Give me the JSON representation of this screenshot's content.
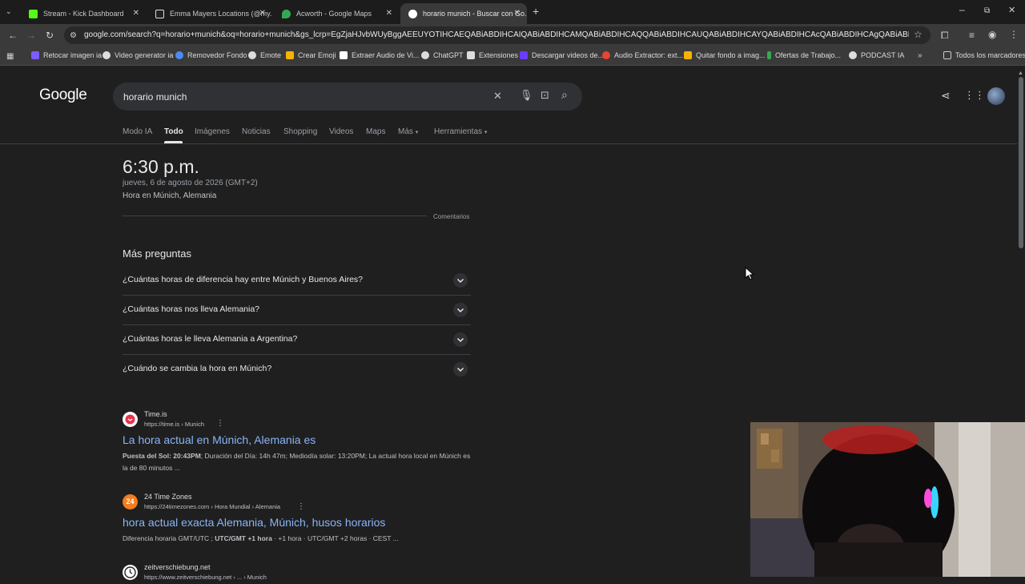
{
  "browser": {
    "tabs": [
      {
        "title": "Stream - Kick Dashboard",
        "color": "#53fc18"
      },
      {
        "title": "Emma Mayers Locations (@my...",
        "color": "#ffffff"
      },
      {
        "title": "Acworth - Google Maps",
        "color": "#34a853"
      },
      {
        "title": "horario munich - Buscar con Go...",
        "color": "#ffffff"
      }
    ],
    "url": "google.com/search?q=horario+munich&oq=horario+munich&gs_lcrp=EgZjaHJvbWUyBggAEEUYOTIHCAEQABiABDIHCAIQABiABDIHCAMQABiABDIHCAQQABiABDIHCAUQABiABDIHCAYQABiABDIHCAcQABiABDIHCAgQABiABDIHCAkQABiABNIBCDE...",
    "bookmarks": [
      {
        "label": "Retocar imagen ia",
        "color": "#7b5cff"
      },
      {
        "label": "Video generator ia",
        "color": "#dddddd"
      },
      {
        "label": "Removedor Fondo",
        "color": "#4c8bf5"
      },
      {
        "label": "Emote",
        "color": "#dddddd"
      },
      {
        "label": "Crear Emoji",
        "color": "#f4b400"
      },
      {
        "label": "Extraer Audio de Vi...",
        "color": "#ffffff"
      },
      {
        "label": "ChatGPT",
        "color": "#dddddd"
      },
      {
        "label": "Extensiones",
        "color": "#dddddd"
      },
      {
        "label": "Descargar videos de...",
        "color": "#6b3cff"
      },
      {
        "label": "Audio Extractor: ext...",
        "color": "#ea4335"
      },
      {
        "label": "Quitar fondo a imag...",
        "color": "#f4b400"
      },
      {
        "label": "Ofertas de Trabajo...",
        "color": "#34a853"
      },
      {
        "label": "PODCAST IA",
        "color": "#dddddd"
      }
    ],
    "all_bookmarks": "Todos los marcadores"
  },
  "google": {
    "logo": "Google",
    "query": "horario munich",
    "nav": [
      "Modo IA",
      "Todo",
      "Imágenes",
      "Noticias",
      "Shopping",
      "Videos",
      "Maps",
      "Más",
      "Herramientas"
    ],
    "time_card": {
      "time": "6:30 p.m.",
      "date": "jueves, 6 de agosto de 2026 (GMT+2)",
      "place": "Hora en Múnich, Alemania",
      "feedback": "Comentarios"
    },
    "paa": {
      "title": "Más preguntas",
      "questions": [
        "¿Cuántas horas de diferencia hay entre Múnich y Buenos Aires?",
        "¿Cuántas horas nos lleva Alemania?",
        "¿Cuántas horas le lleva Alemania a Argentina?",
        "¿Cuándo se cambia la hora en Múnich?"
      ]
    },
    "results": [
      {
        "site": "Time.is",
        "url": "https://time.is › Munich",
        "title": "La hora actual en Múnich, Alemania es",
        "snippet_bold": "Puesta del Sol: 20:43PM",
        "snippet": "; Duración del Día: 14h 47m; Mediodía solar: 13:20PM; La actual hora local en Múnich es la de 80 minutos ...",
        "color": "#e8344a"
      },
      {
        "site": "24 Time Zones",
        "url": "https://24timezones.com › Hora Mundial › Alemania",
        "title": "hora actual exacta Alemania, Múnich, husos horarios",
        "snippet_pre": "Diferencia horaria GMT/UTC ; ",
        "snippet_bold": "UTC/GMT +1 hora",
        "snippet": " · +1 hora · UTC/GMT +2 horas · CEST ...",
        "color": "#f57c20",
        "badge": "24"
      },
      {
        "site": "zeitverschiebung.net",
        "url": "https://www.zeitverschiebung.net › ... › Munich",
        "color": "#ffffff"
      }
    ]
  }
}
